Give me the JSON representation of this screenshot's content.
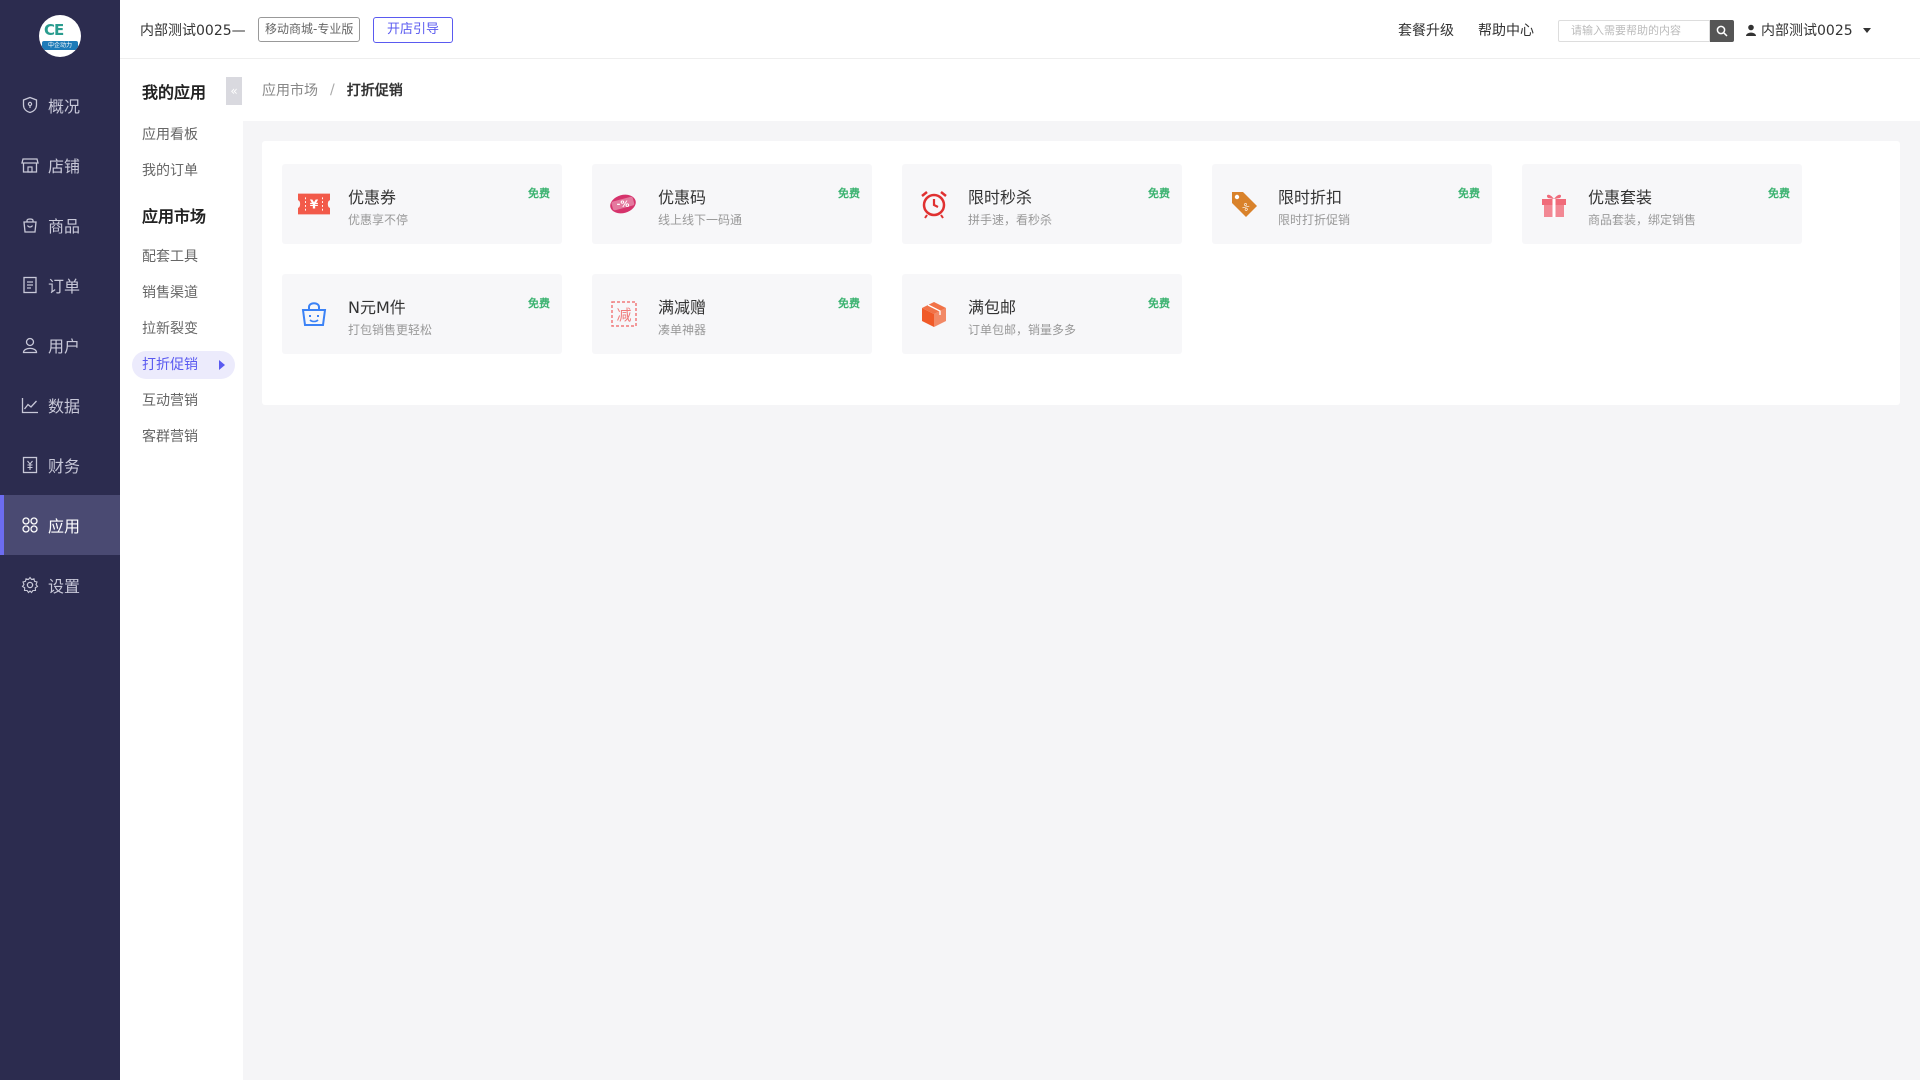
{
  "topbar": {
    "shop_name": "内部测试0025—",
    "plan_badge": "移动商城-专业版",
    "guide_button": "开店引导",
    "upgrade_link": "套餐升级",
    "help_link": "帮助中心",
    "search_placeholder": "请输入需要帮助的内容",
    "username": "内部测试0025"
  },
  "logo": {
    "text": "CE",
    "subtext": "中企动力"
  },
  "leftnav": {
    "items": [
      {
        "label": "概况",
        "icon": "shield-icon"
      },
      {
        "label": "店铺",
        "icon": "store-icon"
      },
      {
        "label": "商品",
        "icon": "bag-icon"
      },
      {
        "label": "订单",
        "icon": "order-icon"
      },
      {
        "label": "用户",
        "icon": "user-icon"
      },
      {
        "label": "数据",
        "icon": "chart-icon"
      },
      {
        "label": "财务",
        "icon": "finance-icon"
      },
      {
        "label": "应用",
        "icon": "apps-icon",
        "active": true
      },
      {
        "label": "设置",
        "icon": "gear-icon"
      }
    ]
  },
  "subsidebar": {
    "group1_title": "我的应用",
    "group1_items": [
      "应用看板",
      "我的订单"
    ],
    "group2_title": "应用市场",
    "group2_items": [
      "配套工具",
      "销售渠道",
      "拉新裂变",
      "打折促销",
      "互动营销",
      "客群营销"
    ],
    "active_item": "打折促销"
  },
  "breadcrumb": {
    "parent": "应用市场",
    "separator": "/",
    "current": "打折促销"
  },
  "apps": [
    {
      "title": "优惠券",
      "desc": "优惠享不停",
      "badge": "免费",
      "icon": "coupon-icon",
      "color": "#f25a4a"
    },
    {
      "title": "优惠码",
      "desc": "线上线下一码通",
      "badge": "免费",
      "icon": "promo-code-icon",
      "color": "#d6336c"
    },
    {
      "title": "限时秒杀",
      "desc": "拼手速，看秒杀",
      "badge": "免费",
      "icon": "alarm-clock-icon",
      "color": "#e03131"
    },
    {
      "title": "限时折扣",
      "desc": "限时打折促销",
      "badge": "免费",
      "icon": "price-tag-icon",
      "color": "#d9822b"
    },
    {
      "title": "优惠套装",
      "desc": "商品套装，绑定销售",
      "badge": "免费",
      "icon": "gift-icon",
      "color": "#f06b7a"
    },
    {
      "title": "N元M件",
      "desc": "打包销售更轻松",
      "badge": "免费",
      "icon": "basket-icon",
      "color": "#3b82f6"
    },
    {
      "title": "满减赠",
      "desc": "凑单神器",
      "badge": "免费",
      "icon": "discount-stamp-icon",
      "color": "#f07a7a"
    },
    {
      "title": "满包邮",
      "desc": "订单包邮，销量多多",
      "badge": "免费",
      "icon": "package-box-icon",
      "color": "#f05a28"
    }
  ]
}
